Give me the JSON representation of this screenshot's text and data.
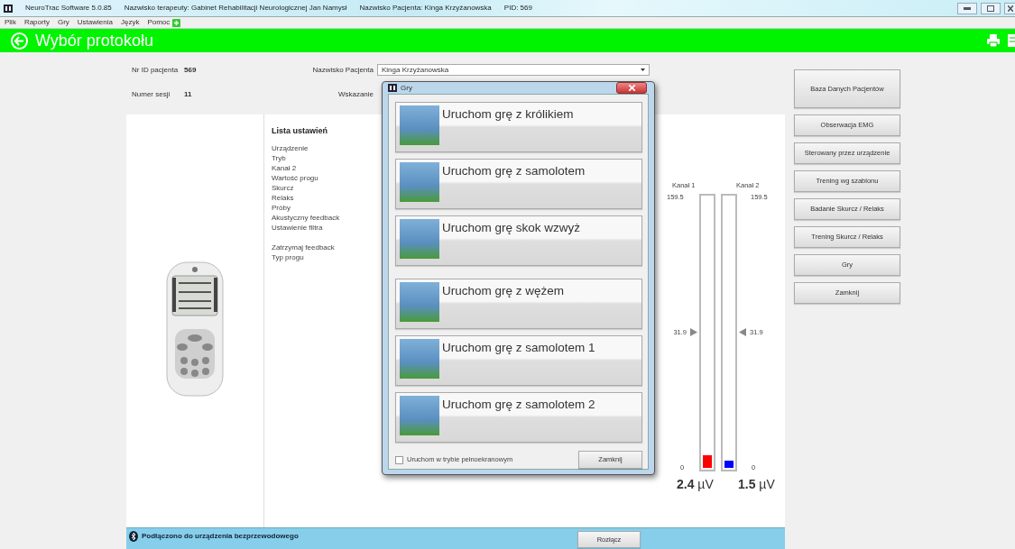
{
  "window": {
    "title_segments": [
      "NeuroTrac Software 5.0.85",
      "Nazwisko terapeuty: Gabinet Rehabilitacji Neurologicznej Jan Namysł",
      "Nazwisko Pacjenta: Kinga Krzyżanowska",
      "PID: 569"
    ]
  },
  "menu": [
    "Plik",
    "Raporty",
    "Gry",
    "Ustawienia",
    "Język",
    "Pomoc"
  ],
  "header": {
    "title": "Wybór protokołu"
  },
  "patient": {
    "id_label": "Nr ID pacjenta",
    "id": "569",
    "session_label": "Numer sesji",
    "session": "11",
    "name_label": "Nazwisko Pacjenta",
    "name": "Kinga Krzyżanowska",
    "indication_label": "Wskazanie"
  },
  "settings": {
    "title": "Lista ustawień",
    "groups": [
      [
        "Urządzenie",
        "Tryb",
        "Kanał 2",
        "Wartość progu",
        "Skurcz",
        "Relaks",
        "Próby",
        "Akustyczny feedback",
        "Ustawienie filtra"
      ],
      [
        "Zatrzymaj feedback",
        "Typ progu"
      ]
    ]
  },
  "channels": [
    {
      "name": "Kanał 1",
      "max": "159.5",
      "min": "0",
      "threshold": {
        "label": "31.9",
        "level": 0.5
      },
      "level": 0.045,
      "color": "#ff0000",
      "reading": "**2.4** µV"
    },
    {
      "name": "Kanał 2",
      "max": "159.5",
      "min": "0",
      "threshold": {
        "label": "31.9",
        "level": 0.5
      },
      "level": 0.025,
      "color": "#0000ff",
      "reading": "**1.5** µV"
    }
  ],
  "side_buttons": [
    {
      "label": "Baza Danych Pacjentów",
      "kind": "large"
    },
    {
      "label": "Obserwacja EMG",
      "kind": "normal"
    },
    {
      "label": "Sterowany przez urządzenie",
      "kind": "normal"
    },
    {
      "label": "Trening wg szablonu",
      "kind": "normal"
    },
    {
      "label": "Badanie Skurcz / Relaks",
      "kind": "normal"
    },
    {
      "label": "Trening Skurcz / Relaks",
      "kind": "normal"
    },
    {
      "label": "Gry",
      "kind": "normal"
    },
    {
      "label": "Zamknij",
      "kind": "normal"
    }
  ],
  "status": {
    "message": "Podłączono do urządzenia bezprzewodowego",
    "button": "Rozłącz"
  },
  "dialog": {
    "title": "Gry",
    "games": [
      "Uruchom grę z królikiem",
      "Uruchom grę z samolotem",
      "Uruchom grę skok wzwyż",
      "Uruchom grę z wężem",
      "Uruchom grę z samolotem 1",
      "Uruchom grę z samolotem 2"
    ],
    "fullscreen": {
      "label": "Uruchom w trybie pełnoekranowym",
      "checked": false
    },
    "close_button": "Zamknij"
  }
}
